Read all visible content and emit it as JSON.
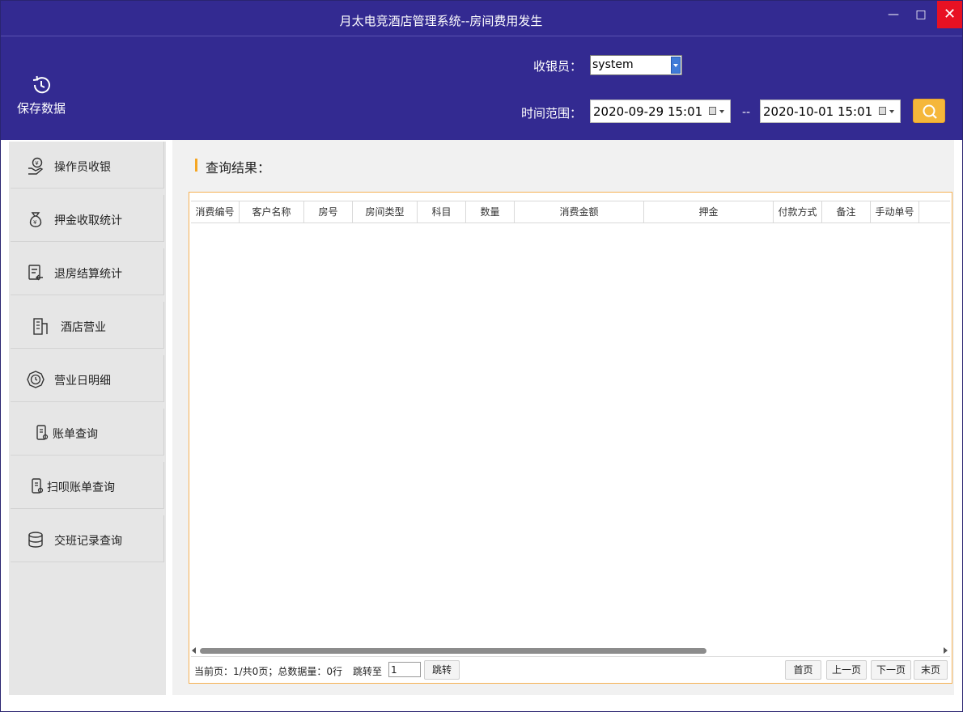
{
  "window": {
    "title": "月太电竞酒店管理系统--房间费用发生",
    "minimize": "—",
    "maximize": "□",
    "close": "✕"
  },
  "toolbar": {
    "save_label": "保存数据"
  },
  "filters": {
    "cashier_label": "收银员：",
    "cashier_value": "system",
    "range_label": "时间范围：",
    "range_separator": "--",
    "start": "2020-09-29 15:01",
    "end": "2020-10-01 15:01"
  },
  "sidebar": {
    "items": [
      {
        "label": "操作员收银",
        "icon": "hand-yen-icon"
      },
      {
        "label": "押金收取统计",
        "icon": "money-bag-icon"
      },
      {
        "label": "退房结算统计",
        "icon": "bill-return-icon"
      },
      {
        "label": "酒店营业",
        "icon": "building-icon"
      },
      {
        "label": "营业日明细",
        "icon": "clock-badge-icon"
      },
      {
        "label": "账单查询",
        "icon": "phone-bill-icon"
      },
      {
        "label": "扫呗账单查询",
        "icon": "scan-bill-icon"
      },
      {
        "label": "交班记录查询",
        "icon": "database-icon"
      }
    ]
  },
  "result": {
    "title": "查询结果：",
    "columns": [
      "消费编号",
      "客户名称",
      "房号",
      "房间类型",
      "科目",
      "数量",
      "消费金额",
      "押金",
      "付款方式",
      "备注",
      "手动单号"
    ],
    "rows": []
  },
  "pager": {
    "info": "当前页：1/共0页；总数据量：0行",
    "jump_label": "跳转至",
    "jump_value": "1",
    "jump_button": "跳转",
    "first": "首页",
    "prev": "上一页",
    "next": "下一页",
    "last": "末页"
  },
  "colors": {
    "header_bg": "#332a91",
    "accent": "#f5a623",
    "search_btn": "#f5b73b",
    "close_btn": "#e81123"
  }
}
